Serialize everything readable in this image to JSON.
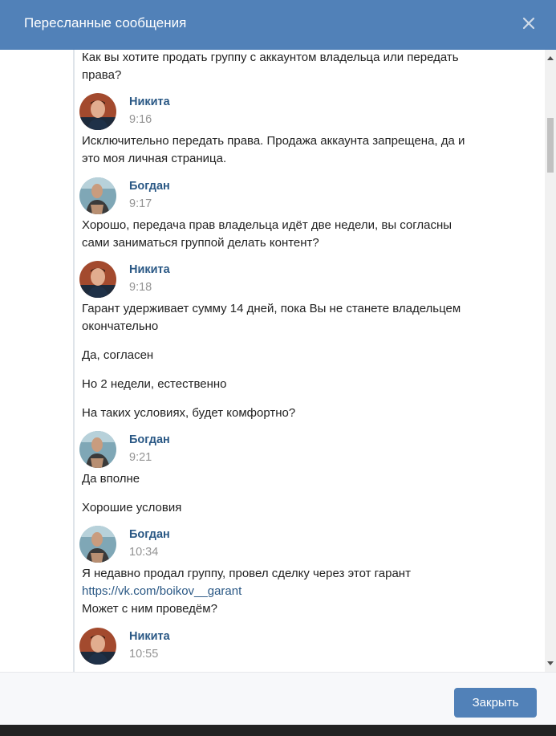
{
  "header": {
    "title": "Пересланные сообщения"
  },
  "messages": {
    "m0": {
      "text1": "Как вы хотите продать группу с аккаунтом владельца или передать",
      "text2": "права?"
    },
    "m1": {
      "author": "Никита",
      "time": "9:16",
      "text1": "Исключительно передать права. Продажа аккаунта запрещена, да и",
      "text2": "это моя личная страница."
    },
    "m2": {
      "author": "Богдан",
      "time": "9:17",
      "text1": "Хорошо, передача прав владельца идёт две недели, вы согласны",
      "text2": "сами заниматься группой делать контент?"
    },
    "m3": {
      "author": "Никита",
      "time": "9:18",
      "text1": "Гарант удерживает сумму 14 дней, пока Вы не станете владельцем",
      "text2": "окончательно",
      "text3": "Да, согласен",
      "text4": "Но 2 недели, естественно",
      "text5": "На таких условиях, будет комфортно?"
    },
    "m4": {
      "author": "Богдан",
      "time": "9:21",
      "text1": "Да вполне",
      "text2": "Хорошие условия"
    },
    "m5": {
      "author": "Богдан",
      "time": "10:34",
      "text1": "Я недавно продал группу, провел сделку через этот гарант",
      "link": "https://vk.com/boikov__garant",
      "text2": "Может с ним проведём?"
    },
    "m6": {
      "author": "Никита",
      "time": "10:55"
    }
  },
  "footer": {
    "close_label": "Закрыть"
  },
  "colors": {
    "header_bg": "#5181b8",
    "author": "#2a5885",
    "time": "#939393"
  }
}
